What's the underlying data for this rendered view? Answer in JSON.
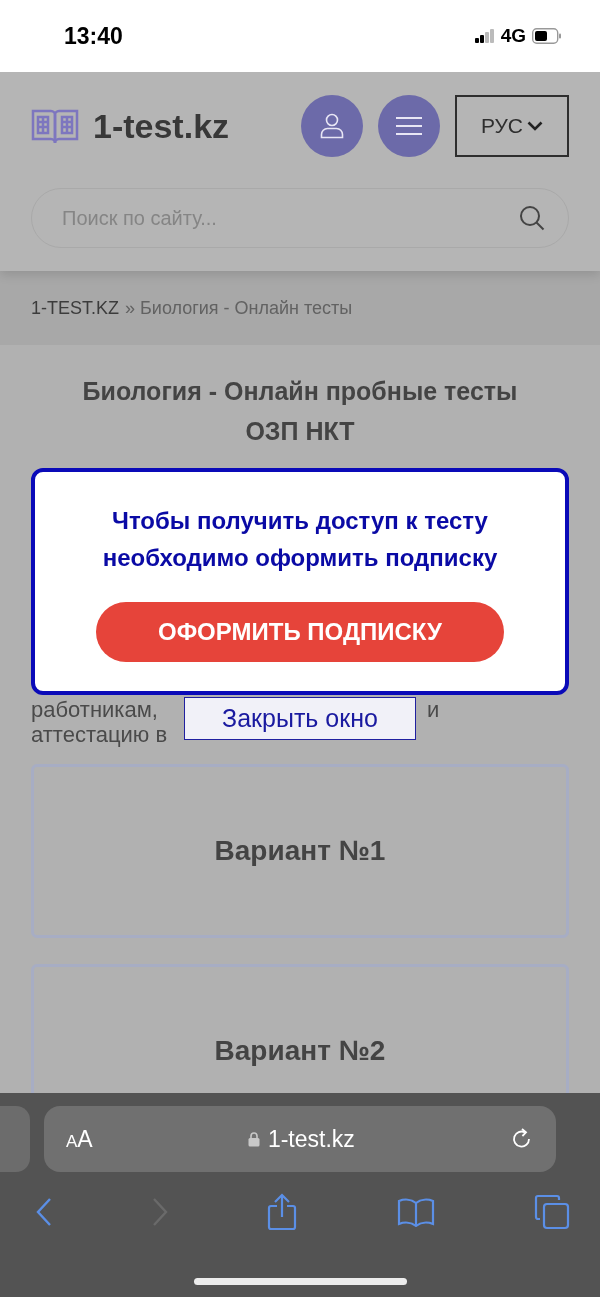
{
  "status_bar": {
    "time": "13:40",
    "network": "4G"
  },
  "header": {
    "logo_text": "1-test.kz",
    "language": "РУС",
    "search": {
      "placeholder": "Поиск по сайту..."
    }
  },
  "breadcrumb": [
    {
      "label": "1-TEST.KZ",
      "kind": "link"
    },
    {
      "label": "» Биология - Онлайн тесты",
      "kind": "current"
    }
  ],
  "page": {
    "title": "Биология - Онлайн пробные тесты ОЗП НКТ",
    "line_1": [
      "работникам,",
      "и"
    ],
    "line_2": "аттестацию в",
    "variants": [
      "Вариант №1",
      "Вариант №2"
    ]
  },
  "modal": {
    "message": "Чтобы получить доступ к тесту необходимо оформить подписку",
    "button": "ОФОРМИТЬ ПОДПИСКУ",
    "close": "Закрыть окно"
  },
  "browser": {
    "text_size": "AA",
    "url": "1-test.kz",
    "forward_disabled": true
  }
}
